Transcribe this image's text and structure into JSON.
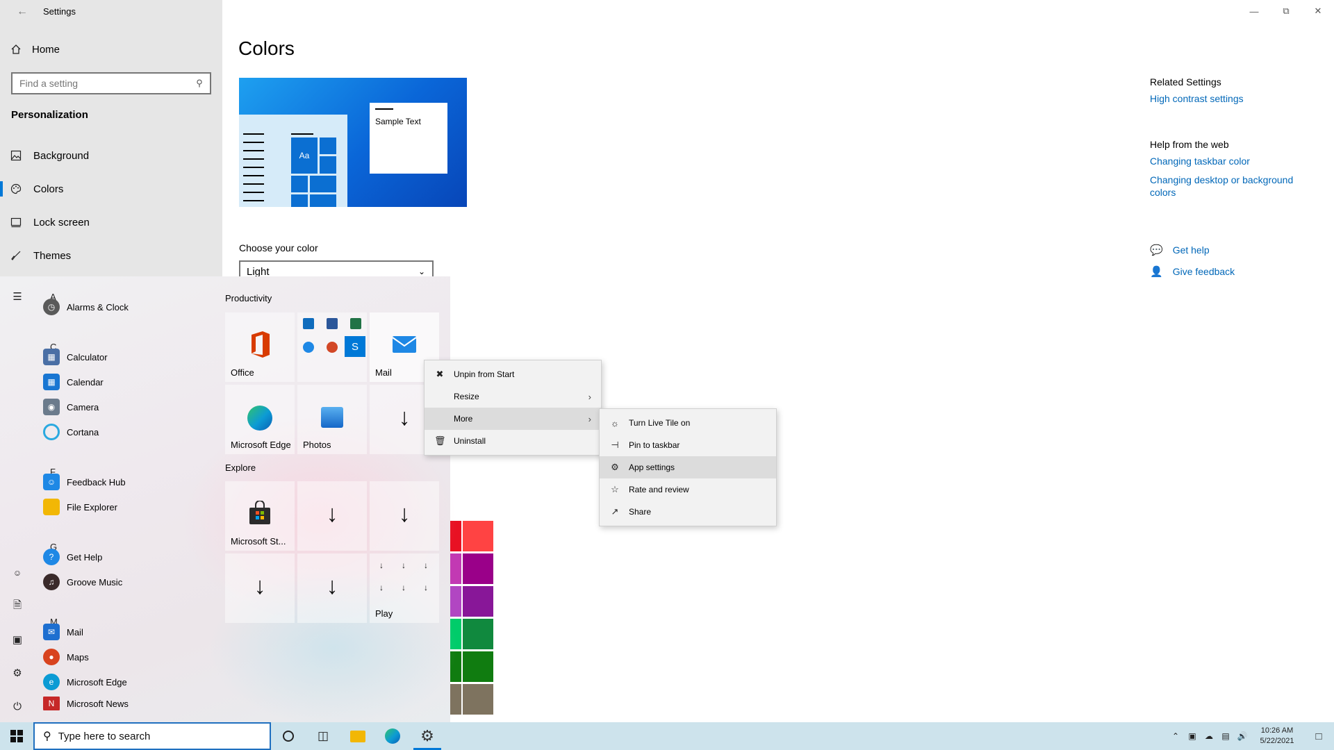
{
  "window": {
    "title": "Settings",
    "controls": [
      "minimize-icon",
      "restore-icon",
      "close-icon"
    ]
  },
  "nav": {
    "home": "Home",
    "search_placeholder": "Find a setting",
    "section": "Personalization",
    "items": [
      {
        "label": "Background",
        "icon": "picture-icon"
      },
      {
        "label": "Colors",
        "icon": "palette-icon",
        "selected": true
      },
      {
        "label": "Lock screen",
        "icon": "lock-screen-icon"
      },
      {
        "label": "Themes",
        "icon": "brush-icon"
      }
    ]
  },
  "main": {
    "title": "Colors",
    "preview_sample_text": "Sample Text",
    "preview_tile_text": "Aa",
    "choose_label": "Choose your color",
    "choose_value": "Light",
    "accent_colors": [
      "#e81123",
      "#ff4343",
      "#c239b3",
      "#9a0089",
      "#b146c2",
      "#881798",
      "#00cc6a",
      "#10893e",
      "#107c10",
      "#107c10",
      "#7e735f",
      "#7e735f"
    ]
  },
  "related": {
    "heading": "Related Settings",
    "links": [
      "High contrast settings"
    ],
    "help_heading": "Help from the web",
    "help_links": [
      "Changing taskbar color",
      "Changing desktop or background colors"
    ],
    "get_help": "Get help",
    "give_feedback": "Give feedback"
  },
  "start_menu": {
    "letters": [
      "A",
      "C",
      "F",
      "G",
      "M"
    ],
    "apps": [
      {
        "label": "Alarms & Clock",
        "color": "#5a5a5a"
      },
      {
        "label": "Calculator",
        "color": "#4a6fa5"
      },
      {
        "label": "Calendar",
        "color": "#1976d2"
      },
      {
        "label": "Camera",
        "color": "#6b7b8c"
      },
      {
        "label": "Cortana",
        "color": "#2aa9e0"
      },
      {
        "label": "Feedback Hub",
        "color": "#1e88e5"
      },
      {
        "label": "File Explorer",
        "color": "#f2b705"
      },
      {
        "label": "Get Help",
        "color": "#1e88e5"
      },
      {
        "label": "Groove Music",
        "color": "#3a2a2a"
      },
      {
        "label": "Mail",
        "color": "#1e6fd0"
      },
      {
        "label": "Maps",
        "color": "#d8431e"
      },
      {
        "label": "Microsoft Edge",
        "color": "#0c9bd4"
      },
      {
        "label": "Microsoft News",
        "color": "#c62828"
      }
    ],
    "groups": [
      "Productivity",
      "Explore"
    ],
    "tiles": {
      "office": "Office",
      "mail": "Mail",
      "edge": "Microsoft Edge",
      "photos": "Photos",
      "store": "Microsoft St...",
      "play": "Play"
    }
  },
  "context_menu": {
    "items": [
      {
        "label": "Unpin from Start",
        "icon": "unpin-icon"
      },
      {
        "label": "Resize",
        "icon": "",
        "submenu": true
      },
      {
        "label": "More",
        "icon": "",
        "submenu": true,
        "highlight": true
      },
      {
        "label": "Uninstall",
        "icon": "trash-icon"
      }
    ]
  },
  "more_menu": {
    "items": [
      {
        "label": "Turn Live Tile on",
        "icon": "live-tile-icon"
      },
      {
        "label": "Pin to taskbar",
        "icon": "pin-icon"
      },
      {
        "label": "App settings",
        "icon": "gear-icon",
        "highlight": true
      },
      {
        "label": "Rate and review",
        "icon": "star-icon"
      },
      {
        "label": "Share",
        "icon": "share-icon"
      }
    ]
  },
  "taskbar": {
    "search_placeholder": "Type here to search",
    "time": "10:26 AM",
    "date": "5/22/2021"
  }
}
